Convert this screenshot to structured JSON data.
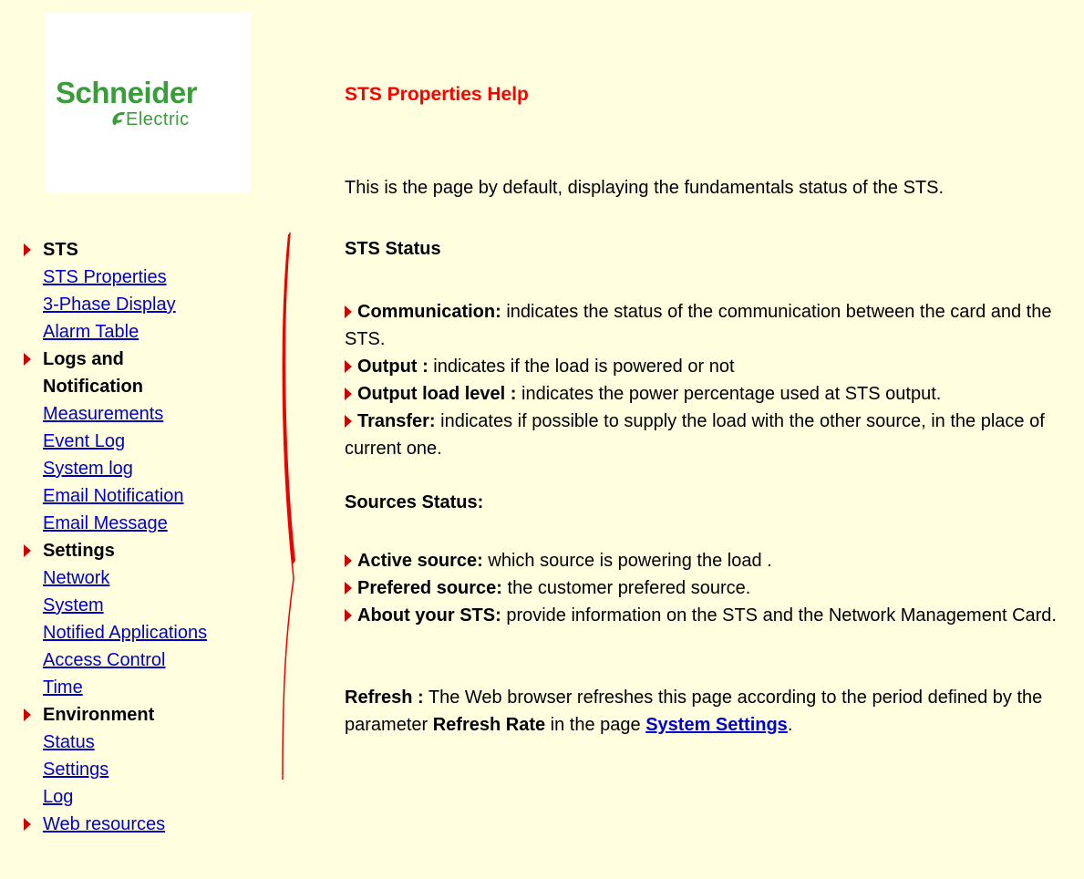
{
  "logo": {
    "line1": "Schneider",
    "line2": "Electric"
  },
  "nav": {
    "sections": [
      {
        "title": "STS",
        "links": [
          "STS Properties",
          "3-Phase Display",
          "Alarm Table"
        ]
      },
      {
        "title_line1": "Logs and",
        "title_line2": "Notification",
        "links": [
          "Measurements",
          "Event Log",
          "System log",
          "Email Notification",
          "Email Message"
        ]
      },
      {
        "title": "Settings",
        "links": [
          "Network",
          "System",
          "Notified Applications",
          "Access Control",
          "Time"
        ]
      },
      {
        "title": "Environment",
        "links": [
          "Status",
          "Settings",
          "Log"
        ]
      },
      {
        "link": "Web resources"
      }
    ]
  },
  "content": {
    "title": "STS Properties Help",
    "intro": "This is the page by default, displaying the fundamentals status of the STS.",
    "sts_status": {
      "heading": "STS Status",
      "items": [
        {
          "label": "Communication:",
          "text": " indicates the status of the communication between the card and the STS."
        },
        {
          "label": "Output :",
          "text": " indicates if the load is powered or not"
        },
        {
          "label": "Output load level :",
          "text": " indicates the power percentage used at STS output."
        },
        {
          "label": "Transfer:",
          "text": " indicates if possible to supply the load with the other source, in the place of current one."
        }
      ]
    },
    "sources_status": {
      "heading": "Sources Status:",
      "items": [
        {
          "label": "Active source:",
          "text": " which source is powering the load ."
        },
        {
          "label": "Prefered source:",
          "text": " the customer prefered source."
        },
        {
          "label": "About your STS:",
          "text": " provide information on the STS and the Network Management Card."
        }
      ]
    },
    "refresh": {
      "label": "Refresh :",
      "text1": " The Web browser refreshes this page according to the period defined by the parameter ",
      "param": "Refresh Rate",
      "text2": " in the page ",
      "link": "System Settings",
      "end": "."
    }
  },
  "colors": {
    "background": "#FFFFE0",
    "title": "#FF0000",
    "link": "#0000CC",
    "logo": "#3B9C3B",
    "bullet": "#CC0000"
  }
}
